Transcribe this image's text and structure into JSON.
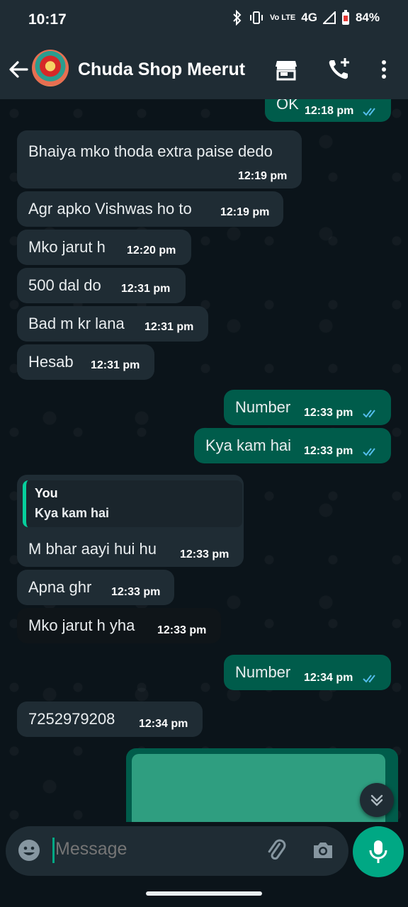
{
  "status_bar": {
    "time": "10:17",
    "volte": "Vo LTE",
    "network": "4G",
    "battery": "84%"
  },
  "header": {
    "title": "Chuda Shop Meerut"
  },
  "messages": [
    {
      "text": "OK",
      "time": "12:18 pm"
    },
    {
      "text": "Bhaiya mko thoda extra paise dedo",
      "time": "12:19 pm"
    },
    {
      "text": "Agr apko Vishwas ho to",
      "time": "12:19 pm"
    },
    {
      "text": "Mko jarut h",
      "time": "12:20 pm"
    },
    {
      "text": "500 dal do",
      "time": "12:31 pm"
    },
    {
      "text": "Bad m kr lana",
      "time": "12:31 pm"
    },
    {
      "text": "Hesab",
      "time": "12:31 pm"
    },
    {
      "text": "Number",
      "time": "12:33 pm"
    },
    {
      "text": "Kya kam hai",
      "time": "12:33 pm"
    },
    {
      "text": "M bhar aayi hui hu",
      "time": "12:33 pm",
      "quote_author": "You",
      "quote_text": "Kya kam hai"
    },
    {
      "text": "Apna ghr",
      "time": "12:33 pm"
    },
    {
      "text": "Mko jarut h yha",
      "time": "12:33 pm"
    },
    {
      "text": "Number",
      "time": "12:34 pm"
    },
    {
      "text": "7252979208",
      "time": "12:34 pm"
    }
  ],
  "input": {
    "placeholder": "Message"
  },
  "colors": {
    "accent": "#00a884",
    "outgoing": "#005c4b",
    "incoming": "#1f2c34",
    "tick_read": "#53bdeb"
  }
}
